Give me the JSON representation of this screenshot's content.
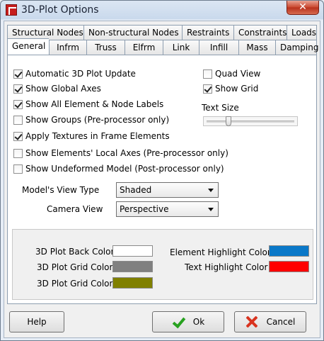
{
  "window": {
    "title": "3D-Plot Options",
    "close_glyph": "✕"
  },
  "tabs": {
    "row1": [
      "Structural Nodes",
      "Non-structural Nodes",
      "Restraints",
      "Constraints",
      "Loads"
    ],
    "row2": [
      "General",
      "Infrm",
      "Truss",
      "Elfrm",
      "Link",
      "Infill",
      "Mass",
      "Damping"
    ],
    "active": "General"
  },
  "general": {
    "checkboxes": [
      {
        "label": "Automatic 3D Plot Update",
        "checked": true
      },
      {
        "label": "Show Global Axes",
        "checked": true
      },
      {
        "label": "Show All Element & Node Labels",
        "checked": true
      },
      {
        "label": "Show Groups (Pre-processor only)",
        "checked": false
      },
      {
        "label": "Apply Textures in Frame Elements",
        "checked": true
      },
      {
        "label": "Show Elements' Local Axes (Pre-processor only)",
        "checked": false
      },
      {
        "label": "Show Undeformed Model (Post-processor only)",
        "checked": false
      }
    ],
    "right_checkboxes": [
      {
        "label": "Quad View",
        "checked": false
      },
      {
        "label": "Show Grid",
        "checked": true
      }
    ],
    "text_size_label": "Text Size",
    "text_size_level": 0.25,
    "view_type": {
      "label": "Model's View Type",
      "value": "Shaded"
    },
    "camera_view": {
      "label": "Camera View",
      "value": "Perspective"
    }
  },
  "colors": {
    "items": [
      {
        "label": "3D Plot Back Color",
        "color": "#ffffff"
      },
      {
        "label": "3D Plot Grid Color",
        "color": "#808080"
      },
      {
        "label": "3D Plot Grid Color",
        "color": "#808000"
      },
      {
        "label": "Element Highlight Color",
        "color": "#0a78c8"
      },
      {
        "label": "Text Highlight Color",
        "color": "#ff0000"
      }
    ]
  },
  "buttons": {
    "help": "Help",
    "ok": "Ok",
    "cancel": "Cancel"
  }
}
